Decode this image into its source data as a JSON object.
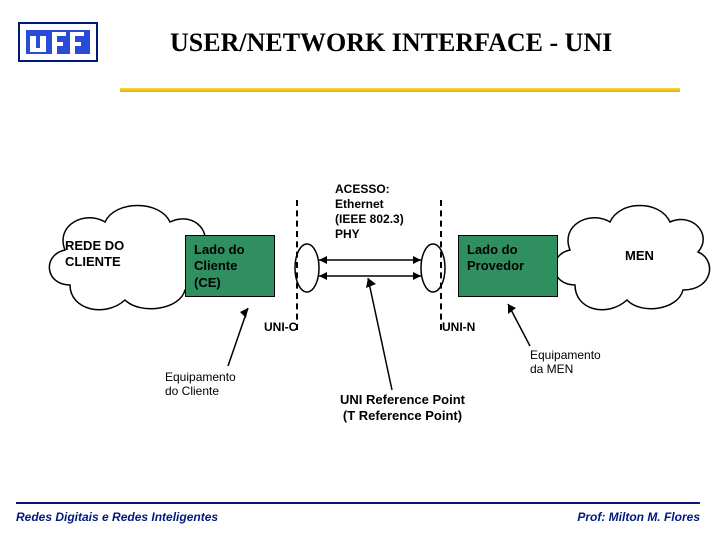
{
  "title": "USER/NETWORK INTERFACE - UNI",
  "footer": {
    "left": "Redes Digitais e Redes Inteligentes",
    "right": "Prof: Milton M. Flores"
  },
  "diagram": {
    "left_cloud_label": "REDE DO\nCLIENTE",
    "right_cloud_label": "MEN",
    "box_ce": "Lado do\nCliente\n(CE)",
    "box_provider": "Lado do\nProvedor",
    "access_label": "ACESSO:\nEthernet\n(IEEE 802.3)\nPHY",
    "uni_c": "UNI-C",
    "uni_n": "UNI-N",
    "equip_client": "Equipamento\ndo Cliente",
    "equip_men": "Equipamento\nda MEN",
    "refpoint": "UNI Reference Point\n(T Reference Point)"
  }
}
